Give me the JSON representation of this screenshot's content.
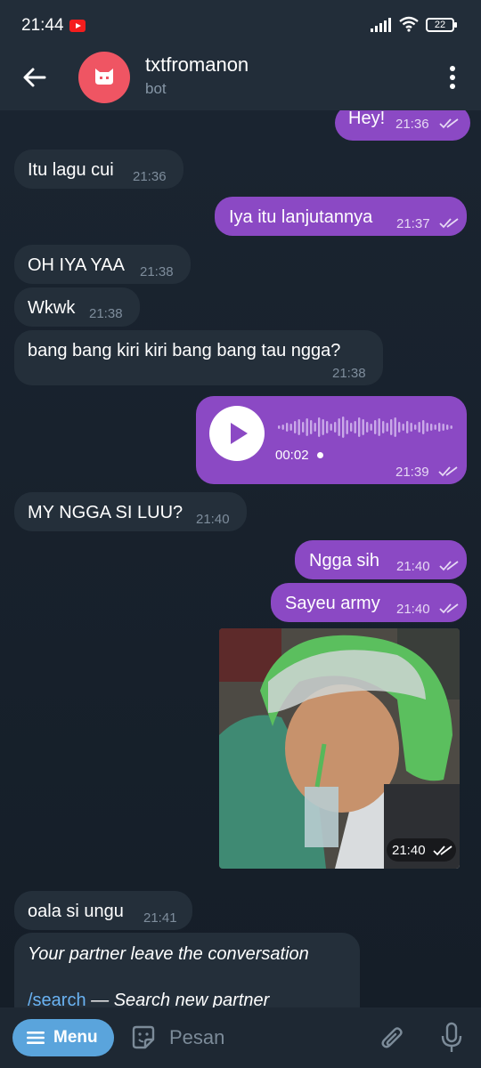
{
  "status_bar": {
    "time": "21:44",
    "battery": "22"
  },
  "header": {
    "title": "txtfromanon",
    "subtitle": "bot"
  },
  "messages": [
    {
      "text": "Hey!",
      "time": "21:36"
    },
    {
      "text": "Itu lagu cui",
      "time": "21:36"
    },
    {
      "text": "Iya itu lanjutannya",
      "time": "21:37"
    },
    {
      "text": "OH IYA YAA",
      "time": "21:38"
    },
    {
      "text": "Wkwk",
      "time": "21:38"
    },
    {
      "text": "bang bang kiri kiri bang bang tau ngga?",
      "time": "21:38"
    },
    {
      "duration": "00:02",
      "time": "21:39"
    },
    {
      "text": "MY NGGA SI LUU?",
      "time": "21:40"
    },
    {
      "text": "Ngga sih",
      "time": "21:40"
    },
    {
      "text": "Sayeu army",
      "time": "21:40"
    },
    {
      "time": "21:40"
    },
    {
      "text": "oala si ungu",
      "time": "21:41"
    },
    {
      "line1": "Your partner leave the conversation",
      "command": "/search",
      "line2": " — Search new partner"
    }
  ],
  "input_bar": {
    "menu_label": "Menu",
    "placeholder": "Pesan"
  },
  "colors": {
    "outgoing": "#8b49c4",
    "incoming": "#242f3a",
    "accent": "#5aa4dc",
    "avatar": "#ef5563"
  }
}
